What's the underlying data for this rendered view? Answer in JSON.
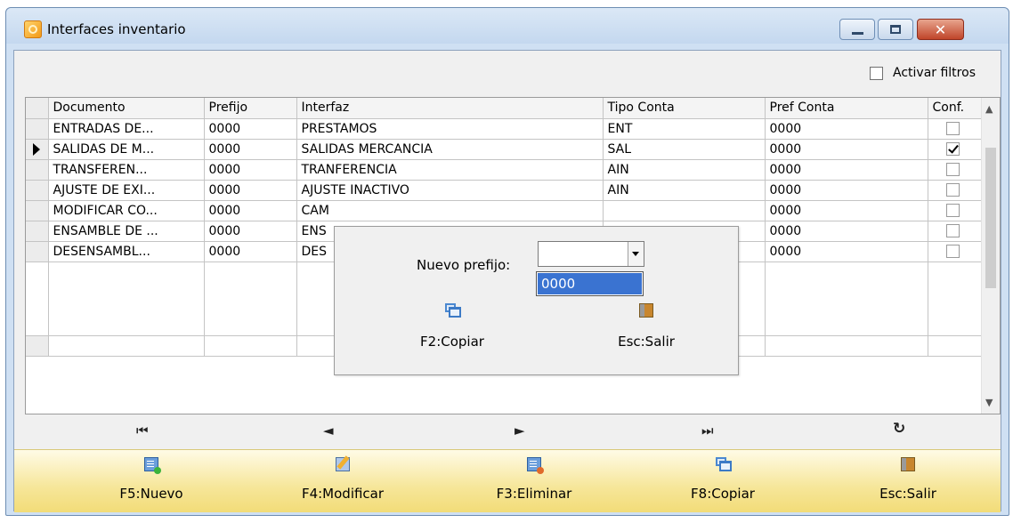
{
  "window": {
    "title": "Interfaces inventario",
    "app_icon": "app-icon"
  },
  "filter": {
    "label": "Activar filtros",
    "checked": false
  },
  "grid": {
    "columns": [
      "Documento",
      "Prefijo",
      "Interfaz",
      "Tipo Conta",
      "Pref Conta",
      "Conf."
    ],
    "rows": [
      {
        "documento": "ENTRADAS DE...",
        "prefijo": "0000",
        "interfaz": "PRESTAMOS",
        "tipo": "ENT",
        "pref": "0000",
        "conf": false
      },
      {
        "documento": "SALIDAS DE M...",
        "prefijo": "0000",
        "interfaz": "SALIDAS MERCANCIA",
        "tipo": "SAL",
        "pref": "0000",
        "conf": true,
        "current": true
      },
      {
        "documento": "TRANSFEREN...",
        "prefijo": "0000",
        "interfaz": "TRANFERENCIA",
        "tipo": "AIN",
        "pref": "0000",
        "conf": false
      },
      {
        "documento": "AJUSTE DE EXI...",
        "prefijo": "0000",
        "interfaz": "AJUSTE INACTIVO",
        "tipo": "AIN",
        "pref": "0000",
        "conf": false
      },
      {
        "documento": "MODIFICAR CO...",
        "prefijo": "0000",
        "interfaz": "CAM",
        "tipo": "",
        "pref": "0000",
        "conf": false
      },
      {
        "documento": "ENSAMBLE DE ...",
        "prefijo": "0000",
        "interfaz": "ENS",
        "tipo": "",
        "pref": "0000",
        "conf": false
      },
      {
        "documento": "DESENSAMBL...",
        "prefijo": "0000",
        "interfaz": "DES",
        "tipo": "",
        "pref": "0000",
        "conf": false
      }
    ]
  },
  "navigator": {
    "first": "⏮",
    "prev": "◄",
    "next": "►",
    "last": "⏭",
    "refresh": "↻"
  },
  "toolbar": {
    "nuevo": "F5:Nuevo",
    "modificar": "F4:Modificar",
    "eliminar": "F3:Eliminar",
    "copiar": "F8:Copiar",
    "salir": "Esc:Salir"
  },
  "dialog": {
    "label": "Nuevo prefijo:",
    "combo_value": "",
    "options": [
      "0000"
    ],
    "copiar": "F2:Copiar",
    "salir": "Esc:Salir"
  },
  "colors": {
    "toolbar_bg": "#f6e699",
    "selection": "#3a73d1",
    "title_bg": "#c4d8ef",
    "close_button": "#c0452a"
  }
}
